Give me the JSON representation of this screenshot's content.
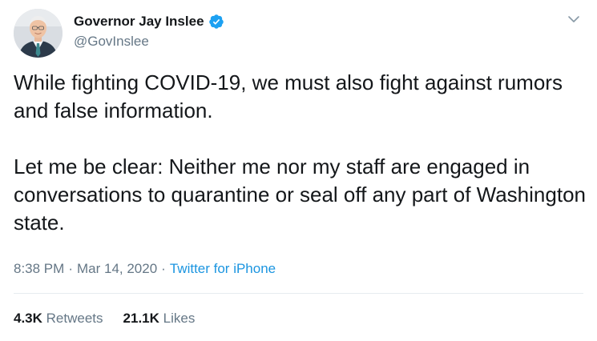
{
  "tweet": {
    "display_name": "Governor Jay Inslee",
    "handle": "@GovInslee",
    "paragraphs": [
      "While fighting COVID-19, we must also fight against rumors and false information.",
      "Let me be clear: Neither me nor my staff are engaged in conversations to quarantine or seal off any part of Washington state."
    ],
    "time": "8:38 PM",
    "date": "Mar 14, 2020",
    "source": "Twitter for iPhone",
    "separator": "·",
    "retweets_count": "4.3K",
    "retweets_label": "Retweets",
    "likes_count": "21.1K",
    "likes_label": "Likes"
  },
  "icons": {
    "verified": "verified-badge-icon",
    "menu": "chevron-down-icon"
  },
  "colors": {
    "text_primary": "#14171a",
    "text_secondary": "#657786",
    "link": "#1b95e0",
    "verified": "#1da1f2",
    "divider": "#e6ecf0"
  }
}
